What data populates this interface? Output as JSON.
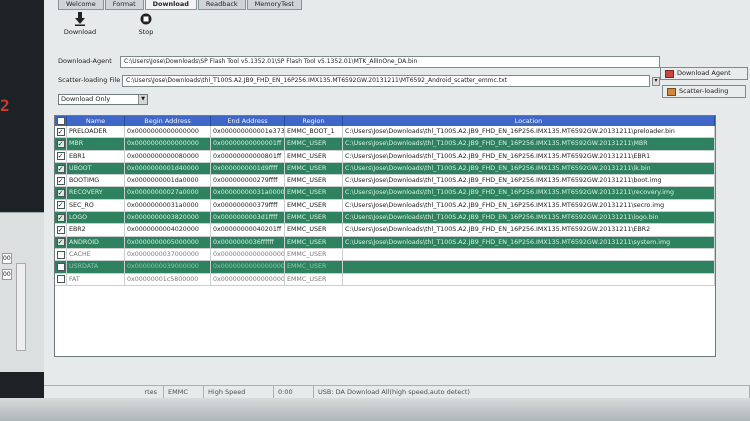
{
  "window": {
    "tabs": [
      "Welcome",
      "Format",
      "Download",
      "Readback",
      "MemoryTest"
    ],
    "active_tab": "Download"
  },
  "left_panel": {
    "red_text": "2",
    "radio_values": [
      "00",
      "00"
    ]
  },
  "toolbar": {
    "download_label": "Download",
    "stop_label": "Stop"
  },
  "download_agent": {
    "label": "Download-Agent",
    "path": "C:\\Users\\Jose\\Downloads\\SP Flash Tool v5.1352.01\\SP Flash Tool v5.1352.01\\MTK_AllInOne_DA.bin",
    "button_label": "Download Agent"
  },
  "scatter": {
    "label": "Scatter-loading File",
    "path": "C:\\Users\\Jose\\Downloads\\thl_T100S.A2.JB9_FHD_EN_16P256.IMX135.MT6592GW.20131211\\MT6592_Android_scatter_emmc.txt",
    "button_label": "Scatter-loading"
  },
  "mode": {
    "selected": "Download Only"
  },
  "table": {
    "headers": [
      "Name",
      "Begin Address",
      "End Address",
      "Region",
      "Location"
    ],
    "rows": [
      {
        "checked": true,
        "style": "plain",
        "name": "PRELOADER",
        "begin": "0x0000000000000000",
        "end": "0x000000000001e373",
        "region": "EMMC_BOOT_1",
        "location": "C:\\Users\\Jose\\Downloads\\thl_T100S.A2.JB9_FHD_EN_16P256.IMX135.MT6592GW.20131211\\preloader.bin"
      },
      {
        "checked": true,
        "style": "sel",
        "name": "MBR",
        "begin": "0x0000000000000000",
        "end": "0x00000000000001ff",
        "region": "EMMC_USER",
        "location": "C:\\Users\\Jose\\Downloads\\thl_T100S.A2.JB9_FHD_EN_16P256.IMX135.MT6592GW.20131211\\MBR"
      },
      {
        "checked": true,
        "style": "plain",
        "name": "EBR1",
        "begin": "0x0000000000080000",
        "end": "0x00000000000801ff",
        "region": "EMMC_USER",
        "location": "C:\\Users\\Jose\\Downloads\\thl_T100S.A2.JB9_FHD_EN_16P256.IMX135.MT6592GW.20131211\\EBR1"
      },
      {
        "checked": true,
        "style": "sel",
        "name": "UBOOT",
        "begin": "0x0000000001d40000",
        "end": "0x0000000001d9ffff",
        "region": "EMMC_USER",
        "location": "C:\\Users\\Jose\\Downloads\\thl_T100S.A2.JB9_FHD_EN_16P256.IMX135.MT6592GW.20131211\\lk.bin"
      },
      {
        "checked": true,
        "style": "plain",
        "name": "BOOTIMG",
        "begin": "0x0000000001da0000",
        "end": "0x000000000279ffff",
        "region": "EMMC_USER",
        "location": "C:\\Users\\Jose\\Downloads\\thl_T100S.A2.JB9_FHD_EN_16P256.IMX135.MT6592GW.20131211\\boot.img"
      },
      {
        "checked": true,
        "style": "sel",
        "name": "RECOVERY",
        "begin": "0x00000000027a0000",
        "end": "0x00000000031a0000",
        "region": "EMMC_USER",
        "location": "C:\\Users\\Jose\\Downloads\\thl_T100S.A2.JB9_FHD_EN_16P256.IMX135.MT6592GW.20131211\\recovery.img"
      },
      {
        "checked": true,
        "style": "plain",
        "name": "SEC_RO",
        "begin": "0x00000000031a0000",
        "end": "0x000000000379ffff",
        "region": "EMMC_USER",
        "location": "C:\\Users\\Jose\\Downloads\\thl_T100S.A2.JB9_FHD_EN_16P256.IMX135.MT6592GW.20131211\\secro.img"
      },
      {
        "checked": true,
        "style": "sel",
        "name": "LOGO",
        "begin": "0x0000000003820000",
        "end": "0x0000000003d1ffff",
        "region": "EMMC_USER",
        "location": "C:\\Users\\Jose\\Downloads\\thl_T100S.A2.JB9_FHD_EN_16P256.IMX135.MT6592GW.20131211\\logo.bin"
      },
      {
        "checked": true,
        "style": "plain",
        "name": "EBR2",
        "begin": "0x0000000004020000",
        "end": "0x00000000040201ff",
        "region": "EMMC_USER",
        "location": "C:\\Users\\Jose\\Downloads\\thl_T100S.A2.JB9_FHD_EN_16P256.IMX135.MT6592GW.20131211\\EBR2"
      },
      {
        "checked": true,
        "style": "sel",
        "name": "ANDROID",
        "begin": "0x0000000005000000",
        "end": "0x0000000036ffffff",
        "region": "EMMC_USER",
        "location": "C:\\Users\\Jose\\Downloads\\thl_T100S.A2.JB9_FHD_EN_16P256.IMX135.MT6592GW.20131211\\system.img"
      },
      {
        "checked": false,
        "style": "dim",
        "name": "CACHE",
        "begin": "0x0000000037000000",
        "end": "0x0000000000000000",
        "region": "EMMC_USER",
        "location": ""
      },
      {
        "checked": false,
        "style": "dimsel",
        "name": "USRDATA",
        "begin": "0x0000000039000000",
        "end": "0x0000000000000000",
        "region": "EMMC_USER",
        "location": ""
      },
      {
        "checked": false,
        "style": "dim",
        "name": "FAT",
        "begin": "0x00000001c5800000",
        "end": "0x0000000000000000",
        "region": "EMMC_USER",
        "location": ""
      }
    ]
  },
  "status": {
    "left": "rtes",
    "storage": "EMMC",
    "speed": "High Speed",
    "time": "0:00",
    "message": "USB: DA Download All(high speed,auto detect)"
  },
  "colors": {
    "header_blue": "#3f67c7",
    "selected_green": "#2e8260",
    "accent_red": "#d2352b"
  }
}
